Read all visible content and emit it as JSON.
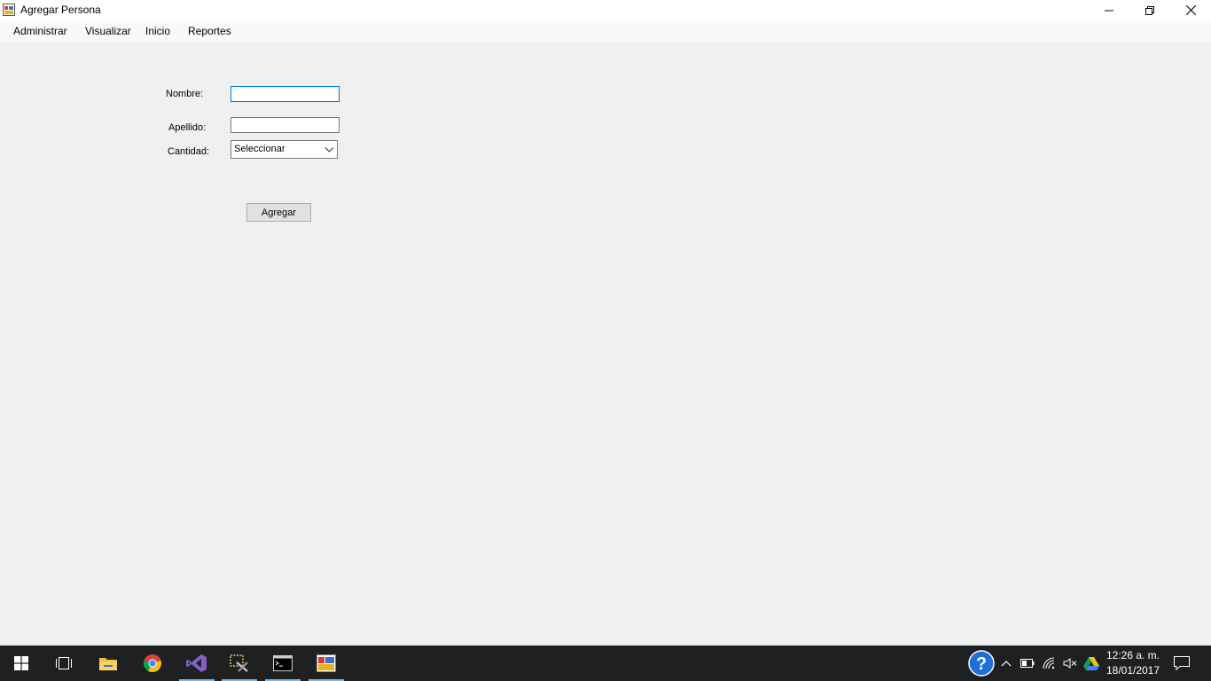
{
  "window": {
    "title": "Agregar Persona"
  },
  "menu": {
    "items": [
      {
        "label": "Administrar"
      },
      {
        "label": "Visualizar"
      },
      {
        "label": "Inicio"
      },
      {
        "label": "Reportes"
      }
    ]
  },
  "form": {
    "nombre_label": "Nombre:",
    "nombre_value": "",
    "apellido_label": "Apellido:",
    "apellido_value": "",
    "cantidad_label": "Cantidad:",
    "cantidad_selected": "Seleccionar",
    "submit_label": "Agregar"
  },
  "taskbar": {
    "apps": [
      {
        "icon": "windows-start-icon"
      },
      {
        "icon": "task-view-icon"
      },
      {
        "icon": "file-explorer-icon"
      },
      {
        "icon": "chrome-icon"
      },
      {
        "icon": "visual-studio-icon"
      },
      {
        "icon": "tools-app-icon"
      },
      {
        "icon": "command-prompt-icon"
      },
      {
        "icon": "form-app-icon"
      }
    ],
    "clock_time": "12:26 a. m.",
    "clock_date": "18/01/2017"
  },
  "colors": {
    "accent": "#0078d7",
    "taskbar_bg": "#1f2021",
    "window_bg": "#f0f0f0"
  }
}
